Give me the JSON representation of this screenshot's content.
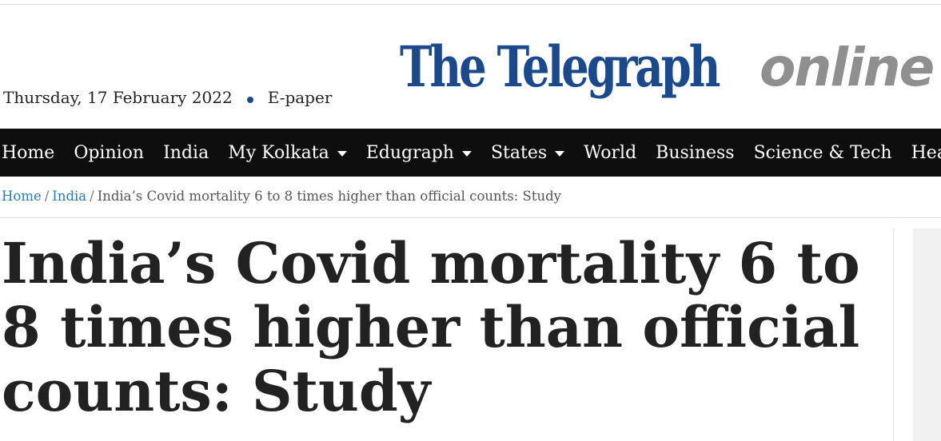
{
  "header": {
    "date": "Thursday, 17 February 2022",
    "epaper_label": "E-paper",
    "logo_text": "The Telegraph",
    "logo_suffix": "online",
    "brand_color": "#1b4a8c",
    "suffix_color": "#8f8f8f"
  },
  "nav": {
    "items": [
      {
        "label": "Home",
        "dropdown": false
      },
      {
        "label": "Opinion",
        "dropdown": false
      },
      {
        "label": "India",
        "dropdown": false
      },
      {
        "label": "My Kolkata",
        "dropdown": true
      },
      {
        "label": "Edugraph",
        "dropdown": true
      },
      {
        "label": "States",
        "dropdown": true
      },
      {
        "label": "World",
        "dropdown": false
      },
      {
        "label": "Business",
        "dropdown": false
      },
      {
        "label": "Science & Tech",
        "dropdown": false
      },
      {
        "label": "Health",
        "dropdown": false
      }
    ]
  },
  "breadcrumb": {
    "home": "Home",
    "section": "India",
    "current": "India’s Covid mortality 6 to 8 times higher than official counts: Study"
  },
  "article": {
    "headline": "India’s Covid mortality 6 to 8 times higher than official counts: Study"
  }
}
